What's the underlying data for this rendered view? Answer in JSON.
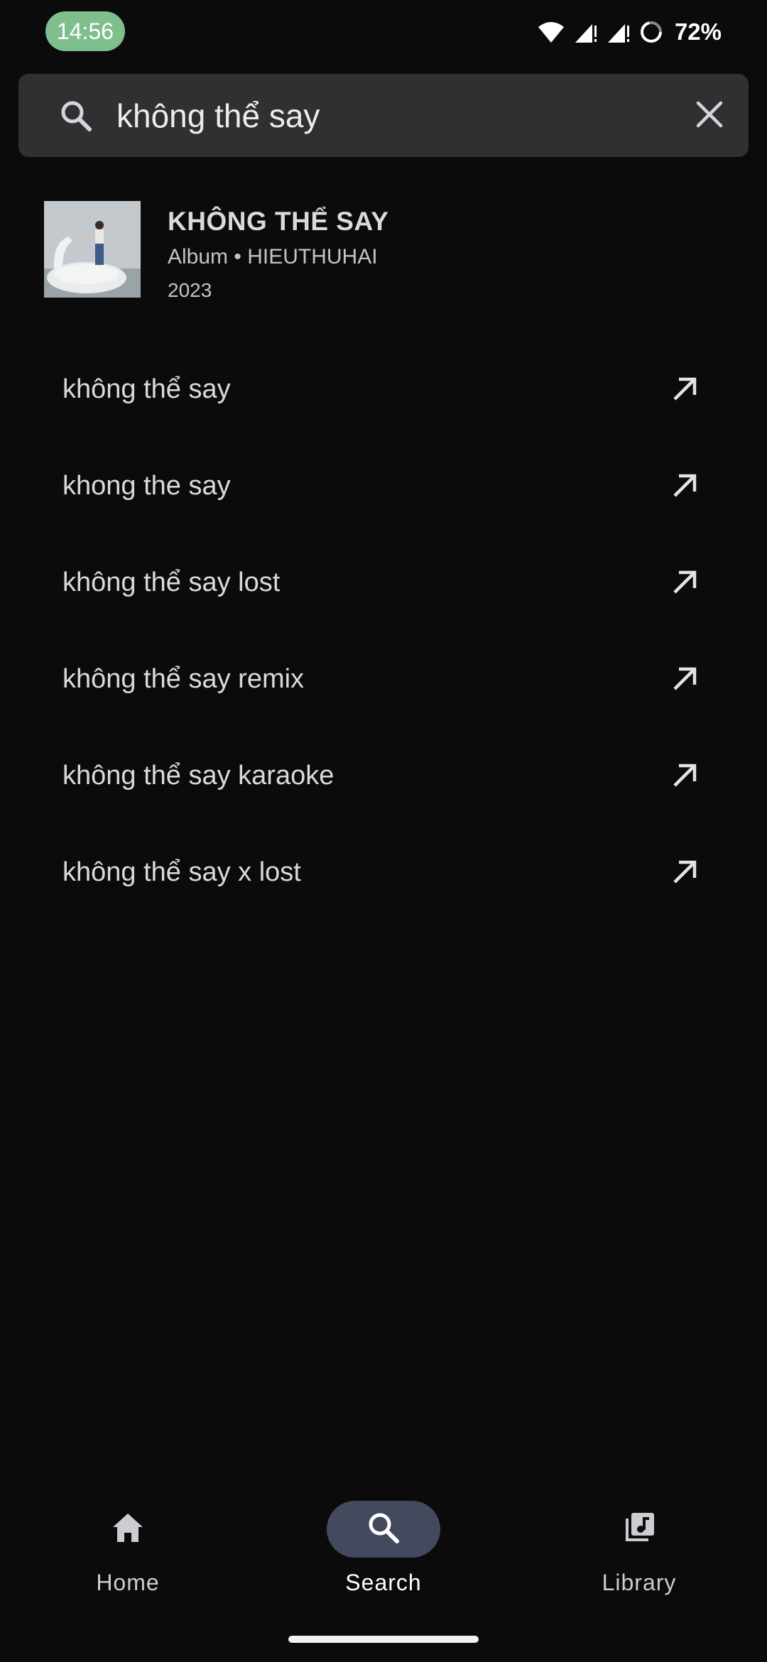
{
  "status_bar": {
    "time": "14:56",
    "battery": "72%",
    "icons": [
      "wifi-icon",
      "signal-icon",
      "signal-icon",
      "battery-icon"
    ]
  },
  "search": {
    "value": "không thể say",
    "placeholder": "",
    "search_icon": "search-icon",
    "clear_icon": "close-icon"
  },
  "album_result": {
    "title": "KHÔNG THỂ SAY",
    "subtitle": "Album • HIEUTHUHAI",
    "year": "2023"
  },
  "suggestions": [
    {
      "text": "không thể say",
      "icon": "arrow-up-left-icon"
    },
    {
      "text": "khong the say",
      "icon": "arrow-up-left-icon"
    },
    {
      "text": "không thể say lost",
      "icon": "arrow-up-left-icon"
    },
    {
      "text": "không thể say remix",
      "icon": "arrow-up-left-icon"
    },
    {
      "text": "không thể say karaoke",
      "icon": "arrow-up-left-icon"
    },
    {
      "text": "không thể say x lost",
      "icon": "arrow-up-left-icon"
    }
  ],
  "bottom_nav": {
    "items": [
      {
        "label": "Home",
        "icon": "home-icon"
      },
      {
        "label": "Search",
        "icon": "search-icon",
        "active": true
      },
      {
        "label": "Library",
        "icon": "library-music-icon"
      }
    ]
  },
  "colors": {
    "background": "#0b0b0c",
    "search_bar": "#303032",
    "clock_pill": "#7fbf8e",
    "active_nav": "#444a5e"
  }
}
